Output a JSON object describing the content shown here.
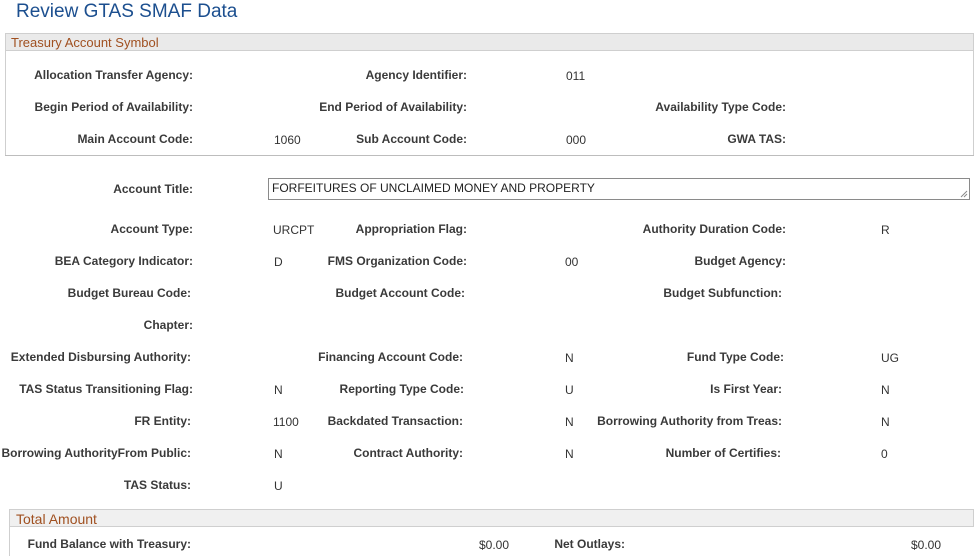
{
  "page": {
    "title": "Review GTAS SMAF Data"
  },
  "treasury_section": {
    "header": "Treasury Account Symbol",
    "fields": {
      "allocation_transfer_agency": {
        "label": "Allocation Transfer Agency:",
        "value": ""
      },
      "agency_identifier": {
        "label": "Agency Identifier:",
        "value": "011"
      },
      "begin_period": {
        "label": "Begin Period of Availability:",
        "value": ""
      },
      "end_period": {
        "label": "End Period of Availability:",
        "value": ""
      },
      "availability_type_code": {
        "label": "Availability Type Code:",
        "value": ""
      },
      "main_account_code": {
        "label": "Main Account Code:",
        "value": "1060"
      },
      "sub_account_code": {
        "label": "Sub Account Code:",
        "value": "000"
      },
      "gwa_tas": {
        "label": "GWA TAS:",
        "value": ""
      }
    }
  },
  "details": {
    "account_title": {
      "label": "Account Title:",
      "value": "FORFEITURES OF UNCLAIMED MONEY AND PROPERTY"
    },
    "account_type": {
      "label": "Account Type:",
      "value": "URCPT"
    },
    "appropriation_flag": {
      "label": "Appropriation Flag:",
      "value": ""
    },
    "authority_duration_code": {
      "label": "Authority Duration Code:",
      "value": "R"
    },
    "bea_category_indicator": {
      "label": "BEA Category Indicator:",
      "value": "D"
    },
    "fms_organization_code": {
      "label": "FMS Organization Code:",
      "value": "00"
    },
    "budget_agency": {
      "label": "Budget Agency:",
      "value": ""
    },
    "budget_bureau_code": {
      "label": "Budget Bureau Code:",
      "value": ""
    },
    "budget_account_code": {
      "label": "Budget Account Code:",
      "value": ""
    },
    "budget_subfunction": {
      "label": "Budget Subfunction:",
      "value": ""
    },
    "chapter": {
      "label": "Chapter:",
      "value": ""
    },
    "extended_disbursing_authority": {
      "label": "Extended Disbursing Authority:",
      "value": ""
    },
    "financing_account_code": {
      "label": "Financing Account Code:",
      "value": "N"
    },
    "fund_type_code": {
      "label": "Fund Type Code:",
      "value": "UG"
    },
    "tas_status_transitioning_flag": {
      "label": "TAS Status Transitioning Flag:",
      "value": "N"
    },
    "reporting_type_code": {
      "label": "Reporting Type Code:",
      "value": "U"
    },
    "is_first_year": {
      "label": "Is First Year:",
      "value": "N"
    },
    "fr_entity": {
      "label": "FR Entity:",
      "value": "1100"
    },
    "backdated_transaction": {
      "label": "Backdated Transaction:",
      "value": "N"
    },
    "borrowing_authority_treas": {
      "label": "Borrowing Authority from Treas:",
      "value": "N"
    },
    "borrowing_authority_public": {
      "label": "Borrowing AuthorityFrom Public:",
      "value": "N"
    },
    "contract_authority": {
      "label": "Contract Authority:",
      "value": "N"
    },
    "number_of_certifies": {
      "label": "Number of Certifies:",
      "value": "0"
    },
    "tas_status": {
      "label": "TAS Status:",
      "value": "U"
    }
  },
  "total_section": {
    "header": "Total Amount",
    "fund_balance": {
      "label": "Fund Balance with Treasury:",
      "value": "$0.00"
    },
    "net_outlays": {
      "label": "Net Outlays:",
      "value": "$0.00"
    }
  }
}
